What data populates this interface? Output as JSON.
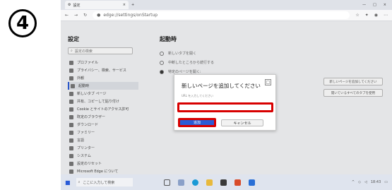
{
  "step_label": "4",
  "browser": {
    "tab_title": "設定",
    "tab_close": "×",
    "url": "edge://settings/onStartup",
    "window_controls": [
      "—",
      "□",
      "×"
    ]
  },
  "sidebar": {
    "title": "設定",
    "search_placeholder": "設定の検索",
    "items": [
      {
        "label": "プロファイル"
      },
      {
        "label": "プライバシー、検索、サービス"
      },
      {
        "label": "外観"
      },
      {
        "label": "起動時"
      },
      {
        "label": "新しいタブ ページ"
      },
      {
        "label": "共有、コピーして貼り付け"
      },
      {
        "label": "Cookie とサイトのアクセス許可"
      },
      {
        "label": "既定のブラウザー"
      },
      {
        "label": "ダウンロード"
      },
      {
        "label": "ファミリー"
      },
      {
        "label": "言語"
      },
      {
        "label": "プリンター"
      },
      {
        "label": "システム"
      },
      {
        "label": "設定のリセット"
      },
      {
        "label": "Microsoft Edge について"
      }
    ]
  },
  "main": {
    "title": "起動時",
    "options": [
      {
        "label": "新しいタブを開く",
        "selected": false
      },
      {
        "label": "中断したところから続行する",
        "selected": false
      },
      {
        "label": "特定のページを開く:",
        "selected": true
      }
    ],
    "right_buttons": [
      "新しいページを追加してください",
      "開いているすべてのタブを使用"
    ]
  },
  "dialog": {
    "title": "新しいページを追加してください",
    "field_label": "URL を入力してください",
    "close": "□",
    "add_button": "追加",
    "cancel_button": "キャンセル",
    "highlight_color": "#d80000",
    "primary_color": "#2a5bd7"
  },
  "taskbar": {
    "search_placeholder": "ここに入力して検索",
    "clock": "18:43"
  }
}
